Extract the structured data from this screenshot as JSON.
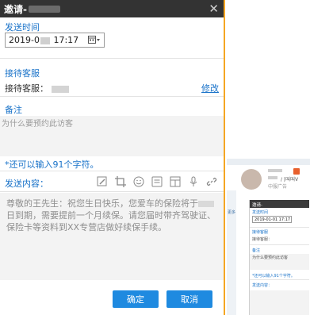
{
  "dialog": {
    "title": "邀请-",
    "close": "✕",
    "send_time_label": "发送时间",
    "date_prefix": "2019-0",
    "date_suffix": " 17:17",
    "service_section_label": "接待客服",
    "service_row_label": "接待客服：",
    "modify_link": "修改",
    "note_label": "备注",
    "note_placeholder": "为什么要预约此访客",
    "char_limit": "*还可以输入91个字符。",
    "content_label": "发送内容：",
    "message_part1": "尊敬的王先生：祝您生日快乐，您爱车的保险将于",
    "message_part2": "日到期，需要提前一个月续保。请您届时带齐驾驶证、保险卡等资料到XX专营店做好续保手续。",
    "confirm": "确定",
    "cancel": "取消"
  },
  "toolbar_icons": [
    "edit-icon",
    "crop-icon",
    "emoji-icon",
    "template-icon",
    "table-icon",
    "voice-icon",
    "link-icon"
  ],
  "background": {
    "breadcrumb": "/ |叫叫V",
    "sub_text": "中服广告",
    "sidebar_mark": "更多",
    "mini_dialog": {
      "title": "邀请-",
      "send_time_label": "发送时间",
      "date": "2019-01-01 17:17",
      "service_section_label": "接待客服",
      "service_row_label": "接待客服：",
      "note_label": "备注",
      "note_placeholder": "为什么要预约此访客",
      "char_limit": "*还可以输入91个字符。",
      "content_label": "发送内容："
    }
  },
  "colors": {
    "accent": "#1a73c9",
    "button": "#1f8ae0",
    "title_bar": "#333333",
    "highlight_border": "#f5a623"
  }
}
